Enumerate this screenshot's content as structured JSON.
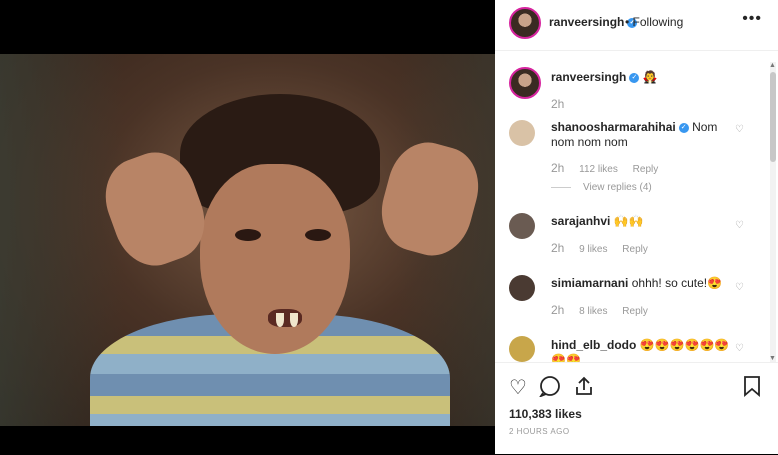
{
  "header": {
    "username": "ranveersingh",
    "separator": "•",
    "following_label": "Following",
    "more_label": "•••"
  },
  "caption": {
    "username": "ranveersingh",
    "text": "🧛",
    "time": "2h"
  },
  "comments": [
    {
      "username": "shanoosharmarahihai",
      "verified": true,
      "text": "Nom nom nom nom",
      "time": "2h",
      "likes": "112 likes",
      "reply": "Reply",
      "view_replies": "View replies (4)"
    },
    {
      "username": "sarajanhvi",
      "text": "🙌🙌",
      "time": "2h",
      "likes": "9 likes",
      "reply": "Reply"
    },
    {
      "username": "simiamarnani",
      "text": "ohhh! so cute!😍",
      "time": "2h",
      "likes": "8 likes",
      "reply": "Reply"
    },
    {
      "username": "hind_elb_dodo",
      "text": "😍😍😍😍😍😍😍😍",
      "time": "",
      "likes": "",
      "reply": ""
    }
  ],
  "footer": {
    "likes": "110,383 likes",
    "posted": "2 hours ago"
  },
  "icons": {
    "heart": "heart-icon",
    "comment": "comment-icon",
    "share": "share-icon",
    "bookmark": "bookmark-icon",
    "verified": "verified-badge-icon"
  },
  "colors": {
    "verified": "#3897f0",
    "text": "#262626",
    "muted": "#999999",
    "avatar_ring": "#d6249f"
  }
}
